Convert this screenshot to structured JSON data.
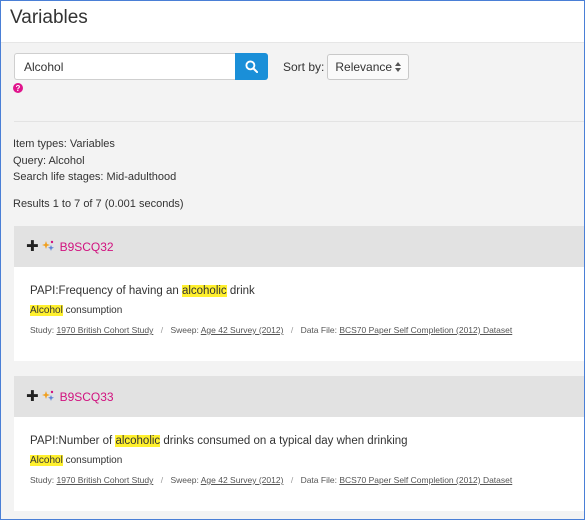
{
  "page": {
    "title": "Variables"
  },
  "search": {
    "value": "Alcohol",
    "button_icon": "search-icon"
  },
  "sort": {
    "label": "Sort by:",
    "selected": "Relevance"
  },
  "help_icon": "?",
  "summary": {
    "item_types": "Item types: Variables",
    "query": "Query: Alcohol",
    "life_stages": "Search life stages: Mid-adulthood",
    "results": "Results 1 to 7 of 7 (0.001 seconds)"
  },
  "results": [
    {
      "id": "B9SCQ32",
      "title_before": "PAPI:Frequency of having an ",
      "title_highlight": "alcoholic",
      "title_after": " drink",
      "topic_highlight": "Alcohol",
      "topic_after": " consumption",
      "study_label": "Study:",
      "study": "1970 British Cohort Study",
      "sweep_label": "Sweep:",
      "sweep": "Age 42 Survey (2012)",
      "datafile_label": "Data File:",
      "datafile": "BCS70 Paper Self Completion (2012) Dataset"
    },
    {
      "id": "B9SCQ33",
      "title_before": "PAPI:Number of ",
      "title_highlight": "alcoholic",
      "title_after": " drinks consumed on a typical day when drinking",
      "topic_highlight": "Alcohol",
      "topic_after": " consumption",
      "study_label": "Study:",
      "study": "1970 British Cohort Study",
      "sweep_label": "Sweep:",
      "sweep": "Age 42 Survey (2012)",
      "datafile_label": "Data File:",
      "datafile": "BCS70 Paper Self Completion (2012) Dataset"
    }
  ],
  "colors": {
    "accent": "#1a8fd8",
    "id_link": "#d1127f",
    "highlight": "#fff02e"
  }
}
